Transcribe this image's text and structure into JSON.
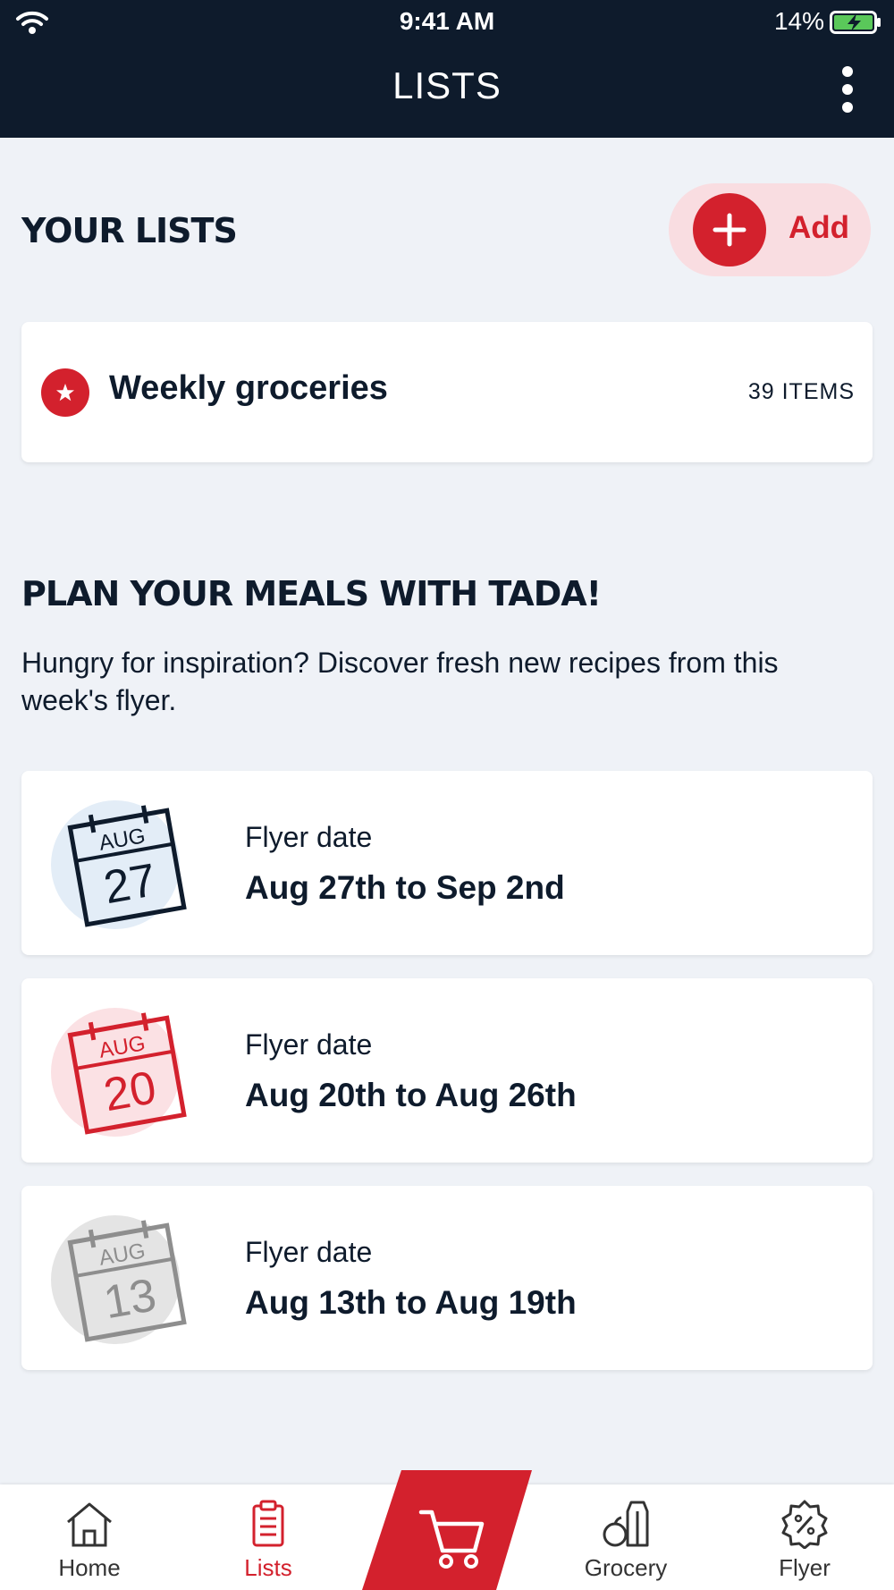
{
  "status": {
    "time": "9:41 AM",
    "battery": "14%"
  },
  "header": {
    "title": "LISTS"
  },
  "your_lists": {
    "title": "YOUR LISTS",
    "add_label": "Add",
    "items": [
      {
        "name": "Weekly groceries",
        "count": "39 ITEMS"
      }
    ]
  },
  "plan": {
    "title": "PLAN YOUR MEALS WITH TADA!",
    "description": "Hungry for inspiration? Discover fresh new recipes from this week's flyer."
  },
  "flyers": [
    {
      "month": "AUG",
      "day": "27",
      "label": "Flyer date",
      "range": "Aug 27th to Sep 2nd",
      "color": "#0e1b2c",
      "circle": "#e3edf7"
    },
    {
      "month": "AUG",
      "day": "20",
      "label": "Flyer date",
      "range": "Aug 20th to Aug 26th",
      "color": "#d3212d",
      "circle": "#fbe1e4"
    },
    {
      "month": "AUG",
      "day": "13",
      "label": "Flyer date",
      "range": "Aug 13th to Aug 19th",
      "color": "#8e8e8e",
      "circle": "#e4e4e4"
    }
  ],
  "nav": {
    "items": [
      {
        "label": "Home",
        "icon": "home-icon"
      },
      {
        "label": "Lists",
        "icon": "clipboard-icon",
        "active": true
      },
      {
        "label": "",
        "icon": "cart-icon"
      },
      {
        "label": "Grocery",
        "icon": "grocery-icon"
      },
      {
        "label": "Flyer",
        "icon": "discount-badge-icon"
      }
    ]
  },
  "colors": {
    "brand": "#d3212d",
    "navy": "#0e1b2c",
    "background": "#eff2f7"
  }
}
